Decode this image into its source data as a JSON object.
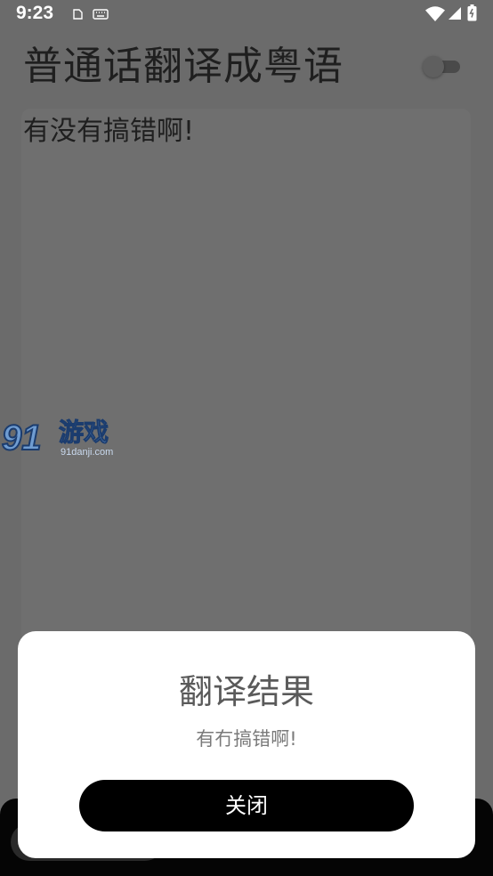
{
  "status_bar": {
    "time": "9:23",
    "icons": [
      "notification-icon",
      "keyboard-icon",
      "wifi-icon",
      "signal-icon",
      "battery-icon"
    ]
  },
  "header": {
    "title": "普通话翻译成粤语",
    "toggle_on": false
  },
  "input": {
    "text": "有没有搞错啊!"
  },
  "watermark": {
    "brand_number": "91",
    "brand_name": "游戏",
    "url": "91danji.com"
  },
  "dialog": {
    "title": "翻译结果",
    "message": "有冇搞错啊!",
    "close_label": "关闭"
  },
  "colors": {
    "overlay": "#6b6b6b",
    "dialog_bg": "#ffffff",
    "button_bg": "#000000",
    "button_text": "#ffffff"
  }
}
